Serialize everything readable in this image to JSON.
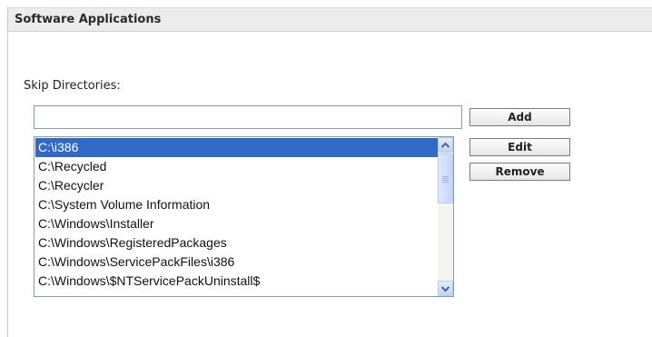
{
  "panel": {
    "title": "Software Applications"
  },
  "skip_directories": {
    "label": "Skip Directories:",
    "input_value": "",
    "items": [
      "C:\\i386",
      "C:\\Recycled",
      "C:\\Recycler",
      "C:\\System Volume Information",
      "C:\\Windows\\Installer",
      "C:\\Windows\\RegisteredPackages",
      "C:\\Windows\\ServicePackFiles\\i386",
      "C:\\Windows\\$NTServicePackUninstall$"
    ],
    "selected_index": 0
  },
  "buttons": {
    "add": "Add",
    "edit": "Edit",
    "remove": "Remove"
  },
  "scrollbar": {
    "up_icon": "scroll-up-arrow-icon",
    "down_icon": "scroll-down-arrow-icon"
  },
  "colors": {
    "selection": "#316ac5",
    "header_bg": "#ececec",
    "input_border": "#7f9db9"
  }
}
